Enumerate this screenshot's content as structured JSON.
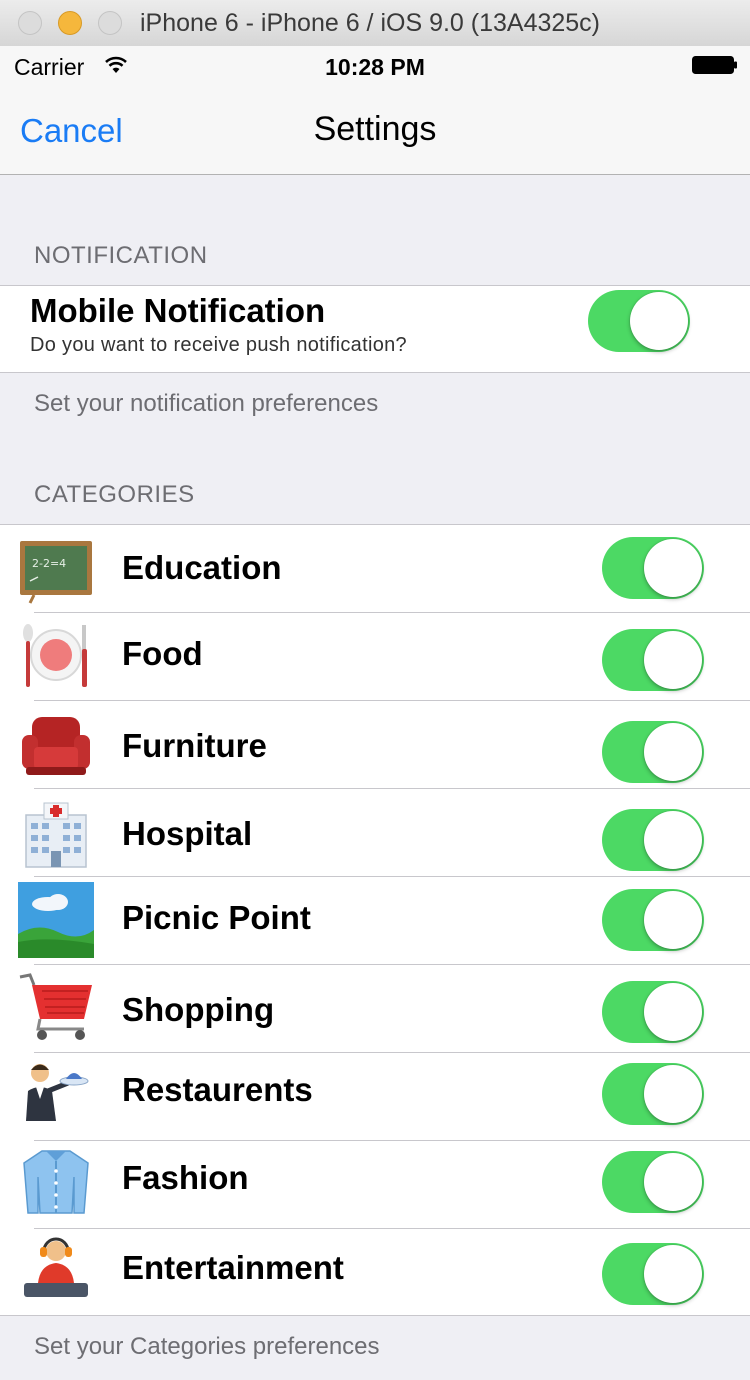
{
  "window": {
    "title": "iPhone 6 - iPhone 6 / iOS 9.0 (13A4325c)"
  },
  "status_bar": {
    "carrier": "Carrier",
    "time": "10:28 PM"
  },
  "nav": {
    "cancel_label": "Cancel",
    "title": "Settings"
  },
  "notification_section": {
    "header": "NOTIFICATION",
    "title": "Mobile Notification",
    "subtitle": "Do you want to receive push notification?",
    "enabled": true,
    "footer": "Set your notification preferences"
  },
  "categories_section": {
    "header": "CATEGORIES",
    "items": [
      {
        "label": "Education",
        "icon": "chalkboard-icon",
        "enabled": true
      },
      {
        "label": "Food",
        "icon": "plate-cutlery-icon",
        "enabled": true
      },
      {
        "label": "Furniture",
        "icon": "armchair-icon",
        "enabled": true
      },
      {
        "label": "Hospital",
        "icon": "hospital-icon",
        "enabled": true
      },
      {
        "label": "Picnic Point",
        "icon": "landscape-icon",
        "enabled": true
      },
      {
        "label": "Shopping",
        "icon": "shopping-cart-icon",
        "enabled": true
      },
      {
        "label": "Restaurents",
        "icon": "waiter-icon",
        "enabled": true
      },
      {
        "label": "Fashion",
        "icon": "shirt-icon",
        "enabled": true
      },
      {
        "label": "Entertainment",
        "icon": "dj-icon",
        "enabled": true
      }
    ],
    "footer": "Set your Categories preferences"
  },
  "colors": {
    "accent": "#1a7cf5",
    "switch_on": "#4cd964",
    "background": "#efeff4"
  }
}
